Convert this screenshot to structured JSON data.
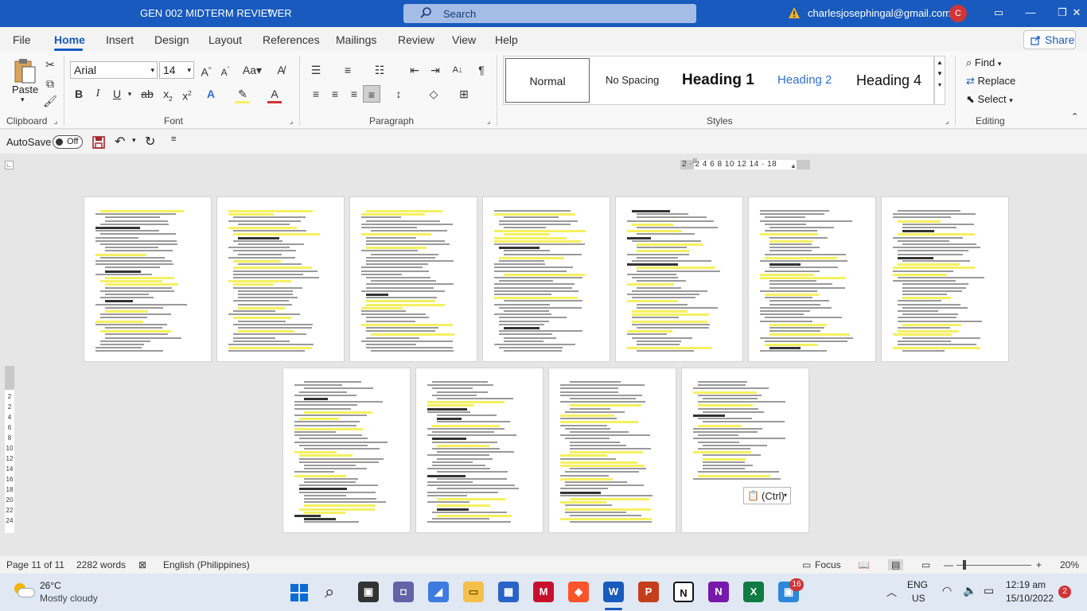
{
  "window": {
    "doc_title": "GEN 002 MIDTERM REVIEWER",
    "search_placeholder": "Search",
    "account_email": "charlesjosephingal@gmail.com",
    "avatar_initial": "C"
  },
  "menu": {
    "tabs": [
      "File",
      "Home",
      "Insert",
      "Design",
      "Layout",
      "References",
      "Mailings",
      "Review",
      "View",
      "Help"
    ],
    "active": "Home",
    "share_label": "Share"
  },
  "ribbon": {
    "clipboard": {
      "paste_label": "Paste",
      "group_label": "Clipboard"
    },
    "font": {
      "family": "Arial",
      "size": "14",
      "group_label": "Font"
    },
    "paragraph": {
      "group_label": "Paragraph"
    },
    "styles": {
      "items": [
        "Normal",
        "No Spacing",
        "Heading 1",
        "Heading 2",
        "Heading 4"
      ],
      "group_label": "Styles"
    },
    "editing": {
      "find": "Find",
      "replace": "Replace",
      "select": "Select",
      "group_label": "Editing"
    }
  },
  "qat": {
    "autosave_label": "AutoSave",
    "autosave_state": "Off"
  },
  "ruler": {
    "numbers": "2   ·   2   4   6   8  10  12  14  ·  18"
  },
  "vruler": {
    "numbers": [
      "2",
      "2",
      "4",
      "6",
      "8",
      "10",
      "12",
      "14",
      "16",
      "18",
      "20",
      "22",
      "24"
    ]
  },
  "paste_options_label": "(Ctrl)",
  "status": {
    "page": "Page 11 of 11",
    "words": "2282 words",
    "language": "English (Philippines)",
    "focus": "Focus",
    "zoom": "20%"
  },
  "taskbar": {
    "weather_temp": "26°C",
    "weather_desc": "Mostly cloudy",
    "lang_top": "ENG",
    "lang_bottom": "US",
    "time": "12:19 am",
    "date": "15/10/2022",
    "notif_count": "2",
    "badge_count": "16"
  }
}
